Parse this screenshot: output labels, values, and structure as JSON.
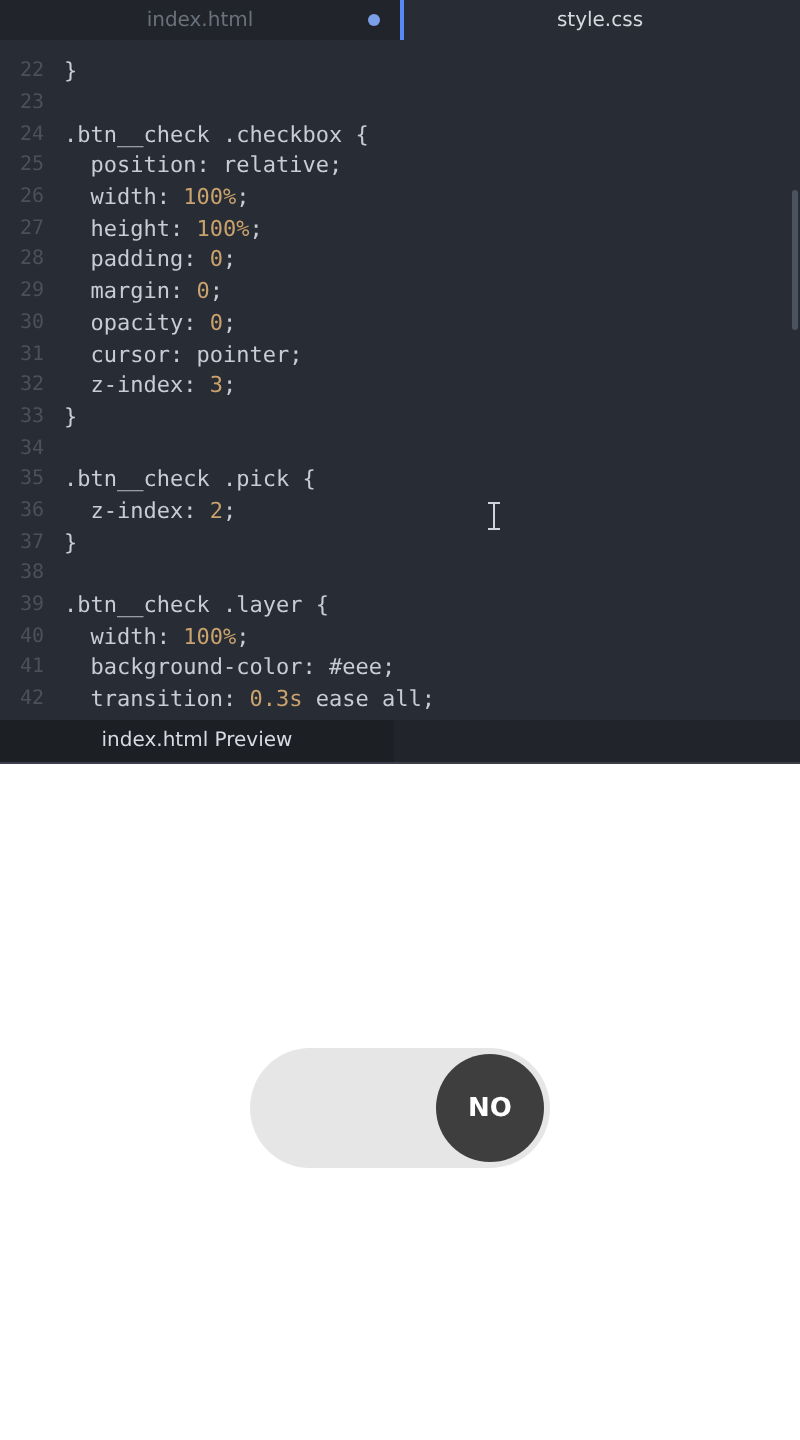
{
  "editor": {
    "tabs": [
      {
        "label": "index.html",
        "selected": false,
        "modified": true
      },
      {
        "label": "style.css",
        "selected": true,
        "modified": false
      }
    ],
    "lines": [
      {
        "number": "22",
        "tokens": [
          {
            "kind": "plain",
            "text": "}"
          }
        ]
      },
      {
        "number": "23"
      },
      {
        "number": "24",
        "tokens": [
          {
            "kind": "plain",
            "text": ".btn__check .checkbox {"
          }
        ]
      },
      {
        "number": "25",
        "tokens": [
          {
            "kind": "plain",
            "text": "  position: relative;"
          }
        ]
      },
      {
        "number": "26",
        "tokens": [
          {
            "kind": "plain",
            "text": "  width: "
          },
          {
            "kind": "num",
            "text": "100%"
          },
          {
            "kind": "plain",
            "text": ";"
          }
        ]
      },
      {
        "number": "27",
        "tokens": [
          {
            "kind": "plain",
            "text": "  height: "
          },
          {
            "kind": "num",
            "text": "100%"
          },
          {
            "kind": "plain",
            "text": ";"
          }
        ]
      },
      {
        "number": "28",
        "tokens": [
          {
            "kind": "plain",
            "text": "  padding: "
          },
          {
            "kind": "num",
            "text": "0"
          },
          {
            "kind": "plain",
            "text": ";"
          }
        ]
      },
      {
        "number": "29",
        "tokens": [
          {
            "kind": "plain",
            "text": "  margin: "
          },
          {
            "kind": "num",
            "text": "0"
          },
          {
            "kind": "plain",
            "text": ";"
          }
        ]
      },
      {
        "number": "30",
        "tokens": [
          {
            "kind": "plain",
            "text": "  opacity: "
          },
          {
            "kind": "num",
            "text": "0"
          },
          {
            "kind": "plain",
            "text": ";"
          }
        ]
      },
      {
        "number": "31",
        "tokens": [
          {
            "kind": "plain",
            "text": "  cursor: pointer;"
          }
        ]
      },
      {
        "number": "32",
        "tokens": [
          {
            "kind": "plain",
            "text": "  z-index: "
          },
          {
            "kind": "num",
            "text": "3"
          },
          {
            "kind": "plain",
            "text": ";"
          }
        ]
      },
      {
        "number": "33",
        "tokens": [
          {
            "kind": "plain",
            "text": "}"
          }
        ]
      },
      {
        "number": "34"
      },
      {
        "number": "35",
        "tokens": [
          {
            "kind": "plain",
            "text": ".btn__check .pick {"
          }
        ]
      },
      {
        "number": "36",
        "tokens": [
          {
            "kind": "plain",
            "text": "  z-index: "
          },
          {
            "kind": "num",
            "text": "2"
          },
          {
            "kind": "plain",
            "text": ";"
          }
        ]
      },
      {
        "number": "37",
        "tokens": [
          {
            "kind": "plain",
            "text": "}"
          }
        ]
      },
      {
        "number": "38"
      },
      {
        "number": "39",
        "tokens": [
          {
            "kind": "plain",
            "text": ".btn__check .layer {"
          }
        ]
      },
      {
        "number": "40",
        "tokens": [
          {
            "kind": "plain",
            "text": "  width: "
          },
          {
            "kind": "num",
            "text": "100%"
          },
          {
            "kind": "plain",
            "text": ";"
          }
        ]
      },
      {
        "number": "41",
        "tokens": [
          {
            "kind": "plain",
            "text": "  background-color: #eee;"
          }
        ]
      },
      {
        "number": "42",
        "tokens": [
          {
            "kind": "plain",
            "text": "  transition: "
          },
          {
            "kind": "num",
            "text": "0.3s"
          },
          {
            "kind": "plain",
            "text": " ease all;"
          }
        ]
      }
    ]
  },
  "preview": {
    "tab": "index.html Preview",
    "toggle": {
      "label": "NO",
      "checked": false
    }
  }
}
